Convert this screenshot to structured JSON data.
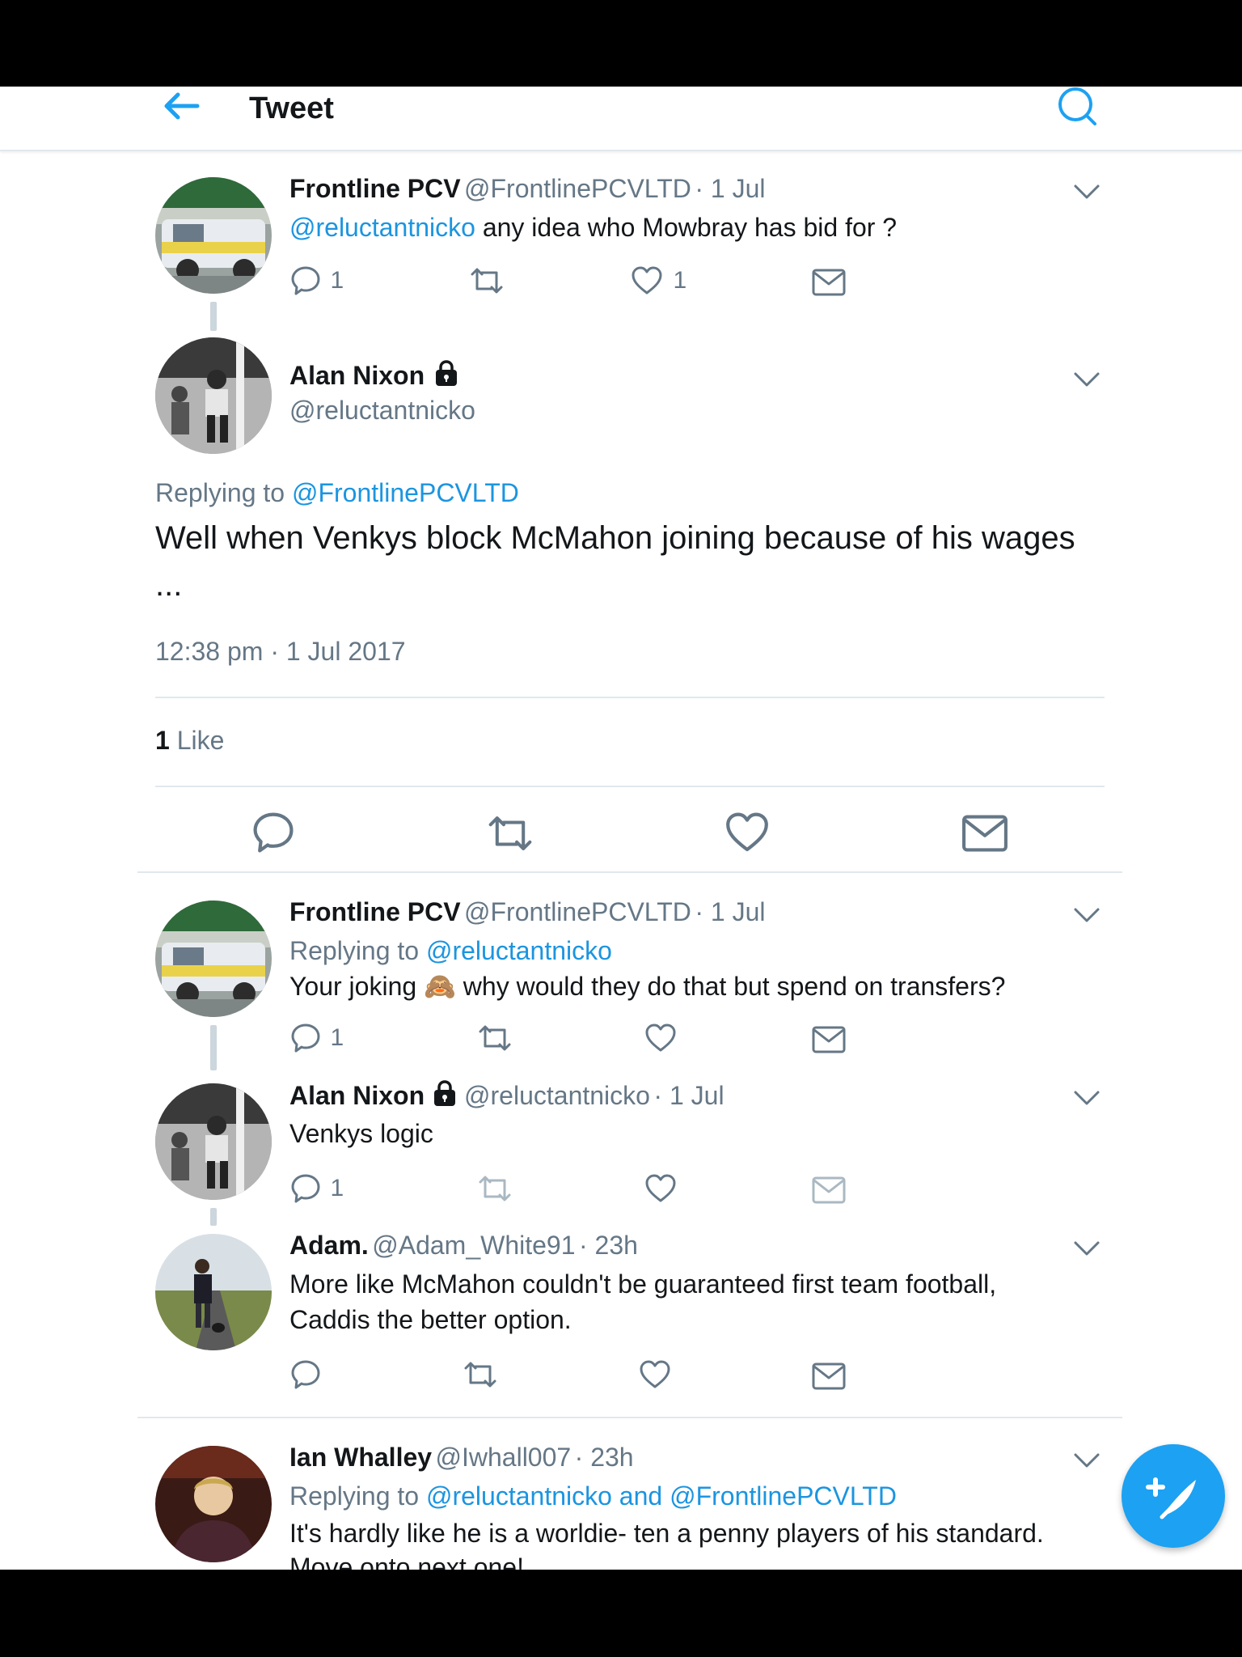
{
  "header": {
    "title": "Tweet"
  },
  "reply1": {
    "name": "Frontline PCV",
    "handle": "@FrontlinePCVLTD",
    "time": "· 1 Jul",
    "mention": "@reluctantnicko",
    "text": " any idea who Mowbray has bid for ?",
    "reply_count": "1",
    "like_count": "1"
  },
  "main_tweet": {
    "name": "Alan Nixon",
    "handle": "@reluctantnicko",
    "replying_prefix": "Replying to ",
    "replying_to": "@FrontlinePCVLTD",
    "text_line1": "Well when Venkys block McMahon joining because of his wages",
    "text_line2": "...",
    "timestamp": "12:38 pm · 1 Jul 2017",
    "like_count": "1",
    "like_label": " Like"
  },
  "reply2": {
    "name": "Frontline PCV",
    "handle": "@FrontlinePCVLTD",
    "time": "· 1 Jul",
    "replying_prefix": "Replying to ",
    "replying_to": "@reluctantnicko",
    "text_before": "Your joking ",
    "emoji": "🙈",
    "text_after": " why would they do that but spend on transfers?",
    "reply_count": "1"
  },
  "reply3": {
    "name": "Alan Nixon",
    "handle": "@reluctantnicko",
    "time": "· 1 Jul",
    "text": "Venkys logic",
    "reply_count": "1"
  },
  "reply4": {
    "name": "Adam.",
    "handle": "@Adam_White91",
    "time": "· 23h",
    "text_line1": "More like McMahon couldn't be guaranteed first team football,",
    "text_line2": "Caddis the better option."
  },
  "reply5": {
    "name": "Ian Whalley",
    "handle": "@Iwhall007",
    "time": "· 23h",
    "replying_prefix": "Replying to ",
    "replying_to": "@reluctantnicko and @FrontlinePCVLTD",
    "text_line1": "It's hardly like he is a worldie- ten a penny players of his standard.",
    "text_line2": "Move onto next one!"
  },
  "colors": {
    "accent": "#1da1f2",
    "link": "#1b95e0",
    "muted": "#657786",
    "text": "#14171a"
  },
  "icons": [
    "back-arrow-icon",
    "search-icon",
    "chevron-down-icon",
    "reply-icon",
    "retweet-icon",
    "like-icon",
    "direct-message-icon",
    "lock-icon",
    "compose-icon"
  ]
}
